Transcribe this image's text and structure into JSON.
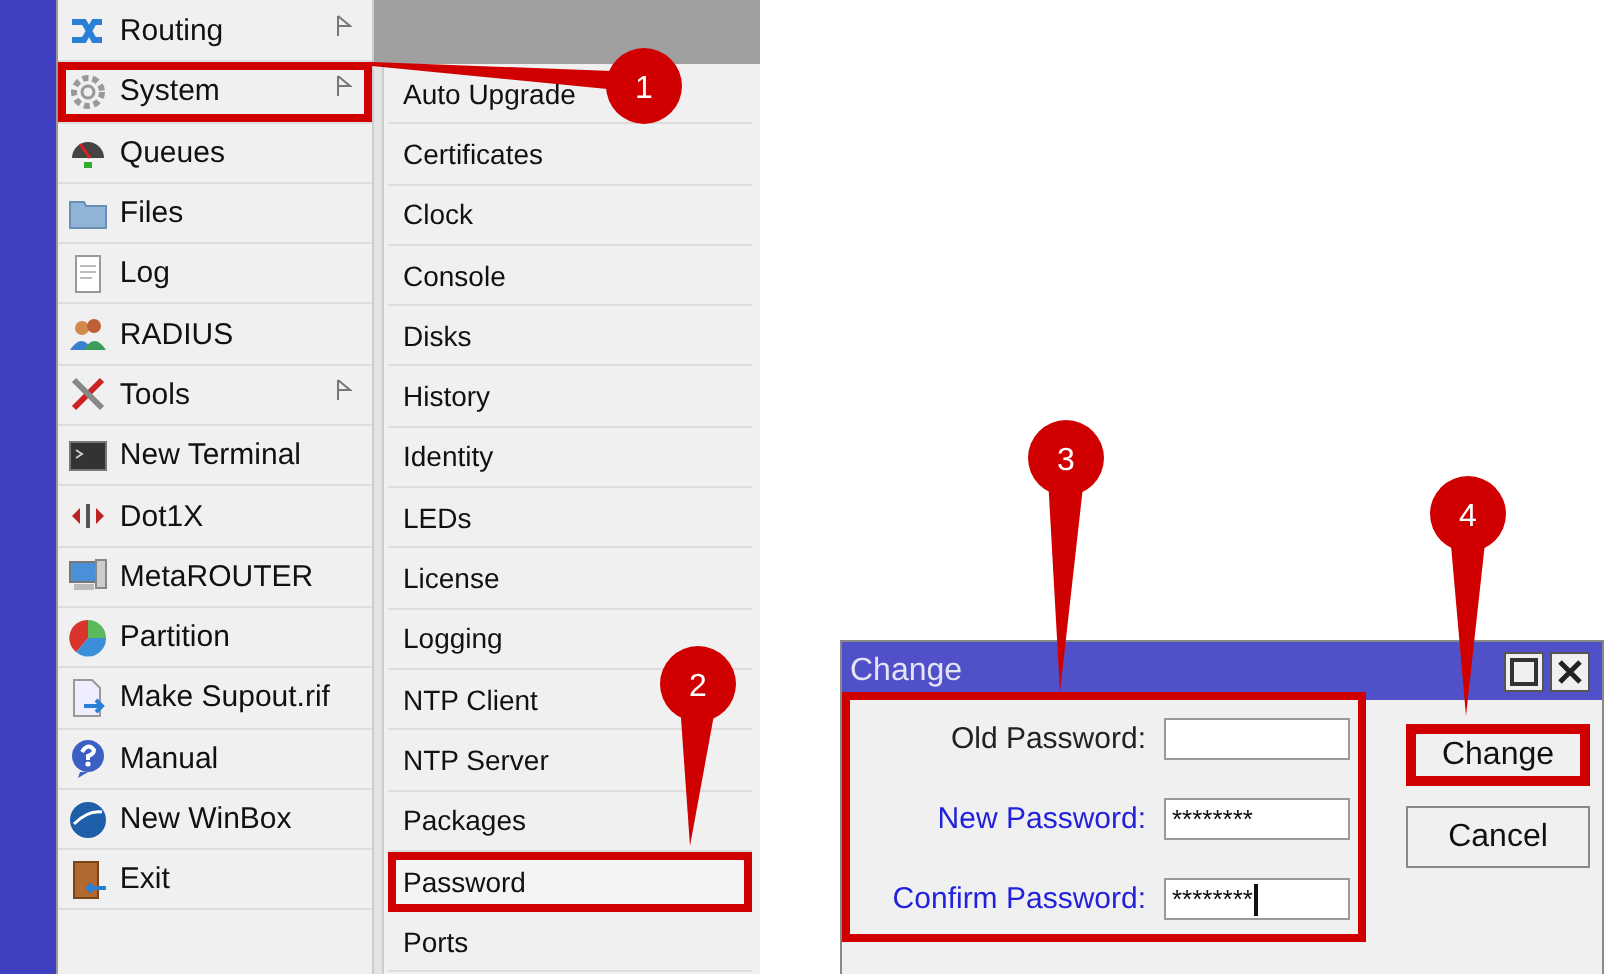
{
  "main_menu": [
    {
      "label": "Routing",
      "has_submenu": true,
      "highlighted": false
    },
    {
      "label": "System",
      "has_submenu": true,
      "highlighted": true
    },
    {
      "label": "Queues",
      "has_submenu": false,
      "highlighted": false
    },
    {
      "label": "Files",
      "has_submenu": false,
      "highlighted": false
    },
    {
      "label": "Log",
      "has_submenu": false,
      "highlighted": false
    },
    {
      "label": "RADIUS",
      "has_submenu": false,
      "highlighted": false
    },
    {
      "label": "Tools",
      "has_submenu": true,
      "highlighted": false
    },
    {
      "label": "New Terminal",
      "has_submenu": false,
      "highlighted": false
    },
    {
      "label": "Dot1X",
      "has_submenu": false,
      "highlighted": false
    },
    {
      "label": "MetaROUTER",
      "has_submenu": false,
      "highlighted": false
    },
    {
      "label": "Partition",
      "has_submenu": false,
      "highlighted": false
    },
    {
      "label": "Make Supout.rif",
      "has_submenu": false,
      "highlighted": false
    },
    {
      "label": "Manual",
      "has_submenu": false,
      "highlighted": false
    },
    {
      "label": "New WinBox",
      "has_submenu": false,
      "highlighted": false
    },
    {
      "label": "Exit",
      "has_submenu": false,
      "highlighted": false
    }
  ],
  "submenu": [
    {
      "label": "Auto Upgrade",
      "highlighted": false
    },
    {
      "label": "Certificates",
      "highlighted": false
    },
    {
      "label": "Clock",
      "highlighted": false
    },
    {
      "label": "Console",
      "highlighted": false
    },
    {
      "label": "Disks",
      "highlighted": false
    },
    {
      "label": "History",
      "highlighted": false
    },
    {
      "label": "Identity",
      "highlighted": false
    },
    {
      "label": "LEDs",
      "highlighted": false
    },
    {
      "label": "License",
      "highlighted": false
    },
    {
      "label": "Logging",
      "highlighted": false
    },
    {
      "label": "NTP Client",
      "highlighted": false
    },
    {
      "label": "NTP Server",
      "highlighted": false
    },
    {
      "label": "Packages",
      "highlighted": false
    },
    {
      "label": "Password",
      "highlighted": true
    },
    {
      "label": "Ports",
      "highlighted": false
    }
  ],
  "dialog": {
    "title": "Change",
    "fields_highlighted": true,
    "fields": [
      {
        "label": "Old Password:",
        "modified": false,
        "focused": false
      },
      {
        "label": "New Password:",
        "value": "********",
        "modified": true,
        "focused": false
      },
      {
        "label": "Confirm Password:",
        "value": "********",
        "modified": true,
        "focused": true
      }
    ],
    "buttons": [
      {
        "label": "Change",
        "highlighted": true
      },
      {
        "label": "Cancel",
        "highlighted": false
      }
    ]
  },
  "callouts": [
    {
      "number": "1"
    },
    {
      "number": "2"
    },
    {
      "number": "3"
    },
    {
      "number": "4"
    }
  ]
}
